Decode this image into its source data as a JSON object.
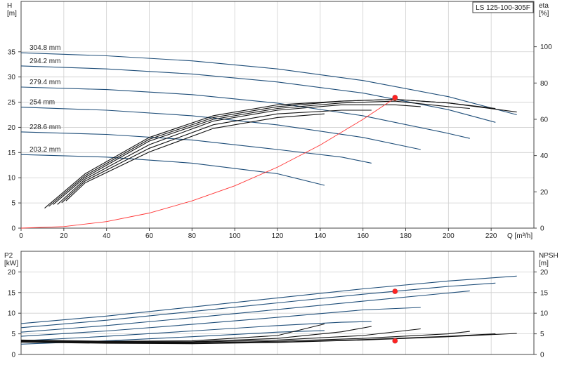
{
  "chart_data": [
    {
      "type": "line",
      "name": "pump-head-curve",
      "title": "LS 125-100-305F",
      "xlabel": "Q [m³/h]",
      "ylabel_left": [
        "H",
        "[m]"
      ],
      "ylabel_right": [
        "eta",
        "[%]"
      ],
      "xlim": [
        0,
        240
      ],
      "ylim": [
        0,
        45
      ],
      "y2lim": [
        0,
        125
      ],
      "x_ticks": [
        0,
        20,
        40,
        60,
        80,
        100,
        120,
        140,
        160,
        180,
        200,
        220
      ],
      "y_ticks": [
        0,
        5,
        10,
        15,
        20,
        25,
        30,
        35
      ],
      "y2_ticks": [
        0,
        20,
        40,
        60,
        80,
        100
      ],
      "grid": true,
      "series": [
        {
          "name": "304.8 mm",
          "axis": "left",
          "color": "#1f4e79",
          "x": [
            0,
            40,
            80,
            120,
            160,
            200,
            232
          ],
          "y": [
            34.8,
            34.2,
            33.2,
            31.6,
            29.3,
            26.1,
            22.5
          ]
        },
        {
          "name": "294.2 mm",
          "axis": "left",
          "color": "#1f4e79",
          "x": [
            0,
            40,
            80,
            120,
            160,
            200,
            222
          ],
          "y": [
            32.2,
            31.6,
            30.6,
            29.0,
            26.8,
            23.5,
            21.0
          ]
        },
        {
          "name": "279.4 mm",
          "axis": "left",
          "color": "#1f4e79",
          "x": [
            0,
            40,
            80,
            120,
            160,
            200,
            210
          ],
          "y": [
            28.0,
            27.5,
            26.5,
            24.8,
            22.3,
            18.8,
            17.8
          ]
        },
        {
          "name": "254 mm",
          "axis": "left",
          "color": "#1f4e79",
          "x": [
            0,
            40,
            80,
            120,
            160,
            187
          ],
          "y": [
            24.0,
            23.4,
            22.3,
            20.5,
            18.0,
            15.6
          ]
        },
        {
          "name": "228.6 mm",
          "axis": "left",
          "color": "#1f4e79",
          "x": [
            0,
            40,
            80,
            120,
            150,
            164
          ],
          "y": [
            19.1,
            18.6,
            17.5,
            15.6,
            14.1,
            12.9
          ]
        },
        {
          "name": "203.2 mm",
          "axis": "left",
          "color": "#1f4e79",
          "x": [
            0,
            40,
            80,
            120,
            142
          ],
          "y": [
            14.6,
            14.1,
            12.9,
            10.8,
            8.5
          ]
        },
        {
          "axis": "right",
          "color": "#111111",
          "x": [
            11,
            30,
            60,
            90,
            120,
            150,
            175,
            200,
            232
          ],
          "y": [
            11,
            30,
            50,
            62,
            68,
            70,
            71,
            69,
            64
          ]
        },
        {
          "axis": "right",
          "color": "#111111",
          "x": [
            13,
            30,
            60,
            90,
            120,
            150,
            175,
            200,
            222
          ],
          "y": [
            12,
            29,
            49,
            61,
            67,
            70,
            71,
            69,
            66
          ]
        },
        {
          "axis": "right",
          "color": "#111111",
          "x": [
            15,
            30,
            60,
            90,
            120,
            150,
            175,
            200,
            210
          ],
          "y": [
            13,
            28,
            48,
            60,
            66,
            69,
            70,
            67,
            66
          ]
        },
        {
          "axis": "right",
          "color": "#111111",
          "x": [
            17,
            30,
            60,
            90,
            120,
            150,
            175,
            187
          ],
          "y": [
            13,
            27,
            46,
            59,
            65,
            68,
            68,
            67
          ]
        },
        {
          "axis": "right",
          "color": "#111111",
          "x": [
            19,
            30,
            60,
            90,
            120,
            150,
            164
          ],
          "y": [
            14,
            26,
            44,
            57,
            63,
            65,
            65
          ]
        },
        {
          "axis": "right",
          "color": "#111111",
          "x": [
            21,
            30,
            60,
            90,
            120,
            142
          ],
          "y": [
            15,
            25,
            42,
            55,
            61,
            63
          ]
        },
        {
          "axis": "left",
          "color": "#ff3333",
          "x": [
            0,
            20,
            40,
            60,
            80,
            100,
            120,
            140,
            160,
            175
          ],
          "y": [
            0,
            0.3,
            1.3,
            3.0,
            5.4,
            8.4,
            12.1,
            16.5,
            21.6,
            25.8
          ]
        }
      ],
      "points": [
        {
          "x": 175,
          "y": 25.8,
          "axis": "left",
          "color": "#ffcc33"
        },
        {
          "x": 175,
          "y": 72,
          "axis": "right",
          "color": "#ff2222"
        }
      ]
    },
    {
      "type": "line",
      "name": "power-npsh-curve",
      "ylabel_left": [
        "P2",
        "[kW]"
      ],
      "ylabel_right": [
        "NPSH",
        "[m]"
      ],
      "xlim": [
        0,
        240
      ],
      "ylim": [
        0,
        25
      ],
      "y2lim": [
        0,
        25
      ],
      "y_ticks": [
        0,
        5,
        10,
        15,
        20
      ],
      "y2_ticks": [
        0,
        5,
        10,
        15,
        20
      ],
      "grid": true,
      "series": [
        {
          "axis": "left",
          "color": "#1f4e79",
          "x": [
            0,
            40,
            80,
            120,
            160,
            200,
            232
          ],
          "y": [
            7.5,
            9.3,
            11.5,
            13.7,
            15.9,
            17.8,
            19.0
          ]
        },
        {
          "axis": "left",
          "color": "#1f4e79",
          "x": [
            0,
            40,
            80,
            120,
            160,
            200,
            222
          ],
          "y": [
            6.5,
            8.3,
            10.4,
            12.5,
            14.6,
            16.5,
            17.3
          ]
        },
        {
          "axis": "left",
          "color": "#1f4e79",
          "x": [
            0,
            40,
            80,
            120,
            160,
            200,
            210
          ],
          "y": [
            5.4,
            7.0,
            8.9,
            10.9,
            12.9,
            14.9,
            15.4
          ]
        },
        {
          "axis": "left",
          "color": "#1f4e79",
          "x": [
            0,
            40,
            80,
            120,
            160,
            187
          ],
          "y": [
            4.4,
            5.7,
            7.3,
            9.0,
            10.8,
            11.4
          ]
        },
        {
          "axis": "left",
          "color": "#1f4e79",
          "x": [
            0,
            40,
            80,
            120,
            150,
            164
          ],
          "y": [
            3.3,
            4.4,
            5.7,
            7.0,
            7.8,
            8.0
          ]
        },
        {
          "axis": "left",
          "color": "#1f4e79",
          "x": [
            0,
            40,
            80,
            120,
            142
          ],
          "y": [
            2.5,
            3.3,
            4.3,
            5.4,
            5.8
          ]
        },
        {
          "axis": "right",
          "color": "#111111",
          "x": [
            0,
            40,
            80,
            120,
            160,
            200,
            232
          ],
          "y": [
            3.0,
            2.7,
            2.6,
            2.9,
            3.5,
            4.3,
            5.1
          ]
        },
        {
          "axis": "right",
          "color": "#111111",
          "x": [
            0,
            40,
            80,
            120,
            160,
            200,
            222
          ],
          "y": [
            3.1,
            2.8,
            2.7,
            3.0,
            3.6,
            4.4,
            5.0
          ]
        },
        {
          "axis": "right",
          "color": "#111111",
          "x": [
            0,
            40,
            80,
            120,
            160,
            200,
            210
          ],
          "y": [
            3.2,
            2.9,
            2.8,
            3.2,
            3.9,
            5.0,
            5.6
          ]
        },
        {
          "axis": "right",
          "color": "#111111",
          "x": [
            0,
            40,
            80,
            120,
            160,
            187
          ],
          "y": [
            3.3,
            3.0,
            3.0,
            3.5,
            4.6,
            6.2
          ]
        },
        {
          "axis": "right",
          "color": "#111111",
          "x": [
            0,
            40,
            80,
            120,
            150,
            164
          ],
          "y": [
            3.4,
            3.1,
            3.1,
            3.9,
            5.5,
            6.8
          ]
        },
        {
          "axis": "right",
          "color": "#111111",
          "x": [
            0,
            40,
            80,
            120,
            142
          ],
          "y": [
            3.5,
            3.2,
            3.3,
            4.6,
            7.4
          ]
        }
      ],
      "points": [
        {
          "x": 175,
          "y": 15.3,
          "axis": "left",
          "color": "#ff2222"
        },
        {
          "x": 175,
          "y": 3.3,
          "axis": "right",
          "color": "#ff2222"
        }
      ]
    }
  ]
}
